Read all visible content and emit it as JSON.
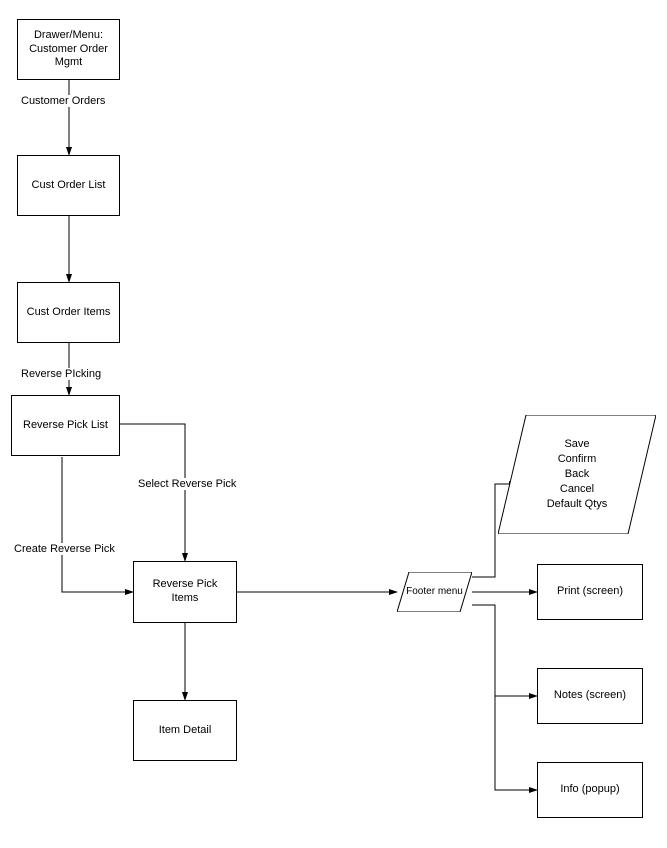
{
  "nodes": {
    "drawer_menu": "Drawer/Menu:\nCustomer Order\nMgmt",
    "cust_order_list": "Cust Order List",
    "cust_order_items": "Cust Order Items",
    "reverse_pick_list": "Reverse Pick List",
    "reverse_pick_items": "Reverse Pick\nItems",
    "item_detail": "Item Detail",
    "footer_menu": "Footer menu",
    "actions_group": "Save\nConfirm\nBack\nCancel\nDefault Qtys",
    "print_screen": "Print (screen)",
    "notes_screen": "Notes (screen)",
    "info_popup": "Info (popup)"
  },
  "edges": {
    "customer_orders": "Customer Orders",
    "reverse_picking": "Reverse PIcking",
    "select_reverse_pick": "Select Reverse Pick",
    "create_reverse_pick": "Create Reverse Pick"
  }
}
